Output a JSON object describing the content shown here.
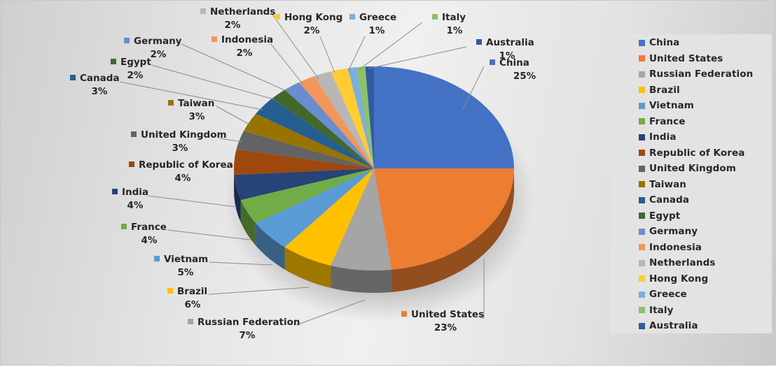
{
  "chart_data": {
    "type": "pie",
    "style": "3d-exploded-none",
    "title": "",
    "start_angle": "12 o'clock",
    "direction": "clockwise",
    "legend_position": "right",
    "data_labels": "category name and percentage with leader lines",
    "slices": [
      {
        "label": "China",
        "value": 25,
        "pct_label": "25%",
        "color": "#4472C4"
      },
      {
        "label": "United States",
        "value": 23,
        "pct_label": "23%",
        "color": "#ED7D31"
      },
      {
        "label": "Russian Federation",
        "value": 7,
        "pct_label": "7%",
        "color": "#A5A5A5"
      },
      {
        "label": "Brazil",
        "value": 6,
        "pct_label": "6%",
        "color": "#FFC000"
      },
      {
        "label": "Vietnam",
        "value": 5,
        "pct_label": "5%",
        "color": "#5B9BD5"
      },
      {
        "label": "France",
        "value": 4,
        "pct_label": "4%",
        "color": "#70AD47"
      },
      {
        "label": "India",
        "value": 4,
        "pct_label": "4%",
        "color": "#264478"
      },
      {
        "label": "Republic of Korea",
        "value": 4,
        "pct_label": "4%",
        "color": "#9E480E"
      },
      {
        "label": "United Kingdom",
        "value": 3,
        "pct_label": "3%",
        "color": "#636363"
      },
      {
        "label": "Taiwan",
        "value": 3,
        "pct_label": "3%",
        "color": "#997300"
      },
      {
        "label": "Canada",
        "value": 3,
        "pct_label": "3%",
        "color": "#255E91"
      },
      {
        "label": "Egypt",
        "value": 2,
        "pct_label": "2%",
        "color": "#43682B"
      },
      {
        "label": "Germany",
        "value": 2,
        "pct_label": "2%",
        "color": "#698ED0"
      },
      {
        "label": "Indonesia",
        "value": 2,
        "pct_label": "2%",
        "color": "#F1975A"
      },
      {
        "label": "Netherlands",
        "value": 2,
        "pct_label": "2%",
        "color": "#B7B7B7"
      },
      {
        "label": "Hong Kong",
        "value": 2,
        "pct_label": "2%",
        "color": "#FFCD33"
      },
      {
        "label": "Greece",
        "value": 1,
        "pct_label": "1%",
        "color": "#7CAFDD"
      },
      {
        "label": "Italy",
        "value": 1,
        "pct_label": "1%",
        "color": "#8CC168"
      },
      {
        "label": "Australia",
        "value": 1,
        "pct_label": "1%",
        "color": "#335AA1"
      }
    ]
  }
}
